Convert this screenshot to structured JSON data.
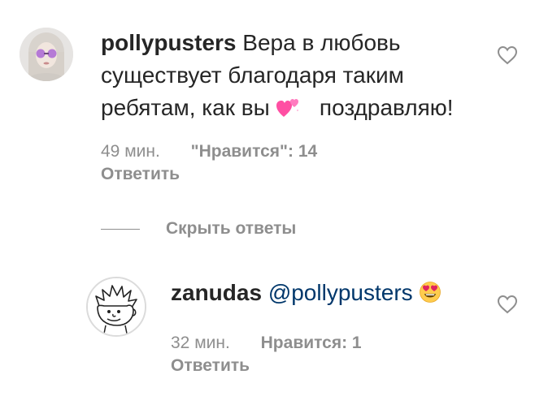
{
  "comments": [
    {
      "username": "pollypusters",
      "text_part1": "Вера в любовь существует благодаря таким ребятам, как вы",
      "emoji_icon": "two-hearts-emoji",
      "text_part2": "поздравляю!",
      "time": "49 мин.",
      "likes": "\"Нравится\": 14",
      "reply_label": "Ответить",
      "avatar_icon": "profile-photo-purple-sunglasses"
    },
    {
      "username": "zanudas",
      "mention": "@pollypusters",
      "emoji_icon": "heart-eyes-emoji",
      "time": "32 мин.",
      "likes": "Нравится: 1",
      "reply_label": "Ответить",
      "avatar_icon": "cartoon-character-avatar"
    }
  ],
  "hide_replies_label": "Скрыть ответы",
  "colors": {
    "primary_text": "#262626",
    "secondary_text": "#8e8e8e",
    "mention": "#00376b",
    "like_outline": "#8e8e8e"
  }
}
